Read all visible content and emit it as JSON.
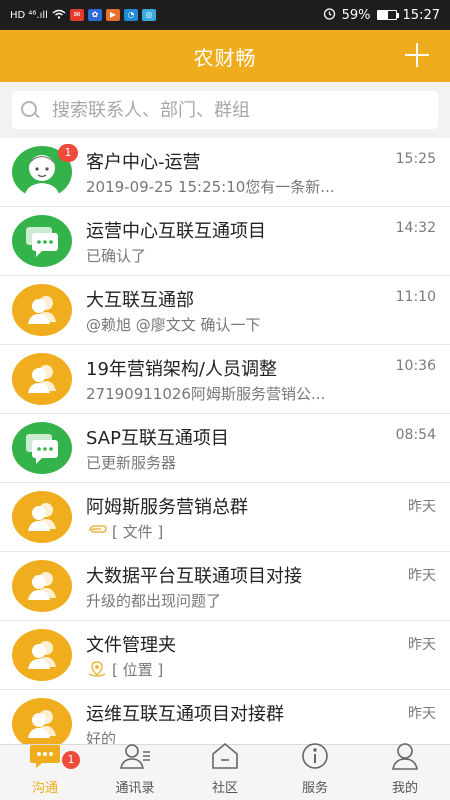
{
  "status_bar": {
    "left_text": "HD ⁴⁶.ıll",
    "battery": "59%",
    "time": "15:27"
  },
  "header": {
    "title": "农财畅"
  },
  "search": {
    "placeholder": "搜索联系人、部门、群组"
  },
  "conversations": [
    {
      "name": "客户中心-运营",
      "time": "15:25",
      "preview": "2019-09-25 15:25:10您有一条新...",
      "avatar": "person",
      "avatar_color": "#34b34a",
      "badge": "1"
    },
    {
      "name": "运营中心互联互通项目",
      "time": "14:32",
      "preview": "已确认了",
      "avatar": "chat",
      "avatar_color": "#34b34a"
    },
    {
      "name": "大互联互通部",
      "time": "11:10",
      "preview": "@赖旭 @廖文文   确认一下",
      "avatar": "group",
      "avatar_color": "#f0ad1e"
    },
    {
      "name": "19年营销架构/人员调整",
      "time": "10:36",
      "preview": "27190911026阿姆斯服务营销公...",
      "avatar": "group",
      "avatar_color": "#f0ad1e"
    },
    {
      "name": "SAP互联互通项目",
      "time": "08:54",
      "preview": "已更新服务器",
      "avatar": "chat",
      "avatar_color": "#34b34a"
    },
    {
      "name": "阿姆斯服务营销总群",
      "time": "昨天",
      "preview": "[ 文件 ]",
      "preview_icon": "attachment-icon",
      "avatar": "group",
      "avatar_color": "#f0ad1e"
    },
    {
      "name": "大数据平台互联通项目对接",
      "time": "昨天",
      "preview": "升级的都出现问题了",
      "avatar": "group",
      "avatar_color": "#f0ad1e"
    },
    {
      "name": "文件管理夹",
      "time": "昨天",
      "preview": "[ 位置 ]",
      "preview_icon": "location-icon",
      "avatar": "group",
      "avatar_color": "#f0ad1e"
    },
    {
      "name": "运维互联互通项目对接群",
      "time": "昨天",
      "preview": "好的",
      "avatar": "group",
      "avatar_color": "#f0ad1e"
    }
  ],
  "tabs": [
    {
      "label": "沟通",
      "icon": "chat-bubble-icon",
      "active": true,
      "badge": "1"
    },
    {
      "label": "通讯录",
      "icon": "contacts-icon"
    },
    {
      "label": "社区",
      "icon": "community-icon"
    },
    {
      "label": "服务",
      "icon": "service-icon"
    },
    {
      "label": "我的",
      "icon": "profile-icon"
    }
  ],
  "colors": {
    "accent": "#efac1c",
    "green": "#34b34a",
    "badge": "#f04a3a"
  }
}
